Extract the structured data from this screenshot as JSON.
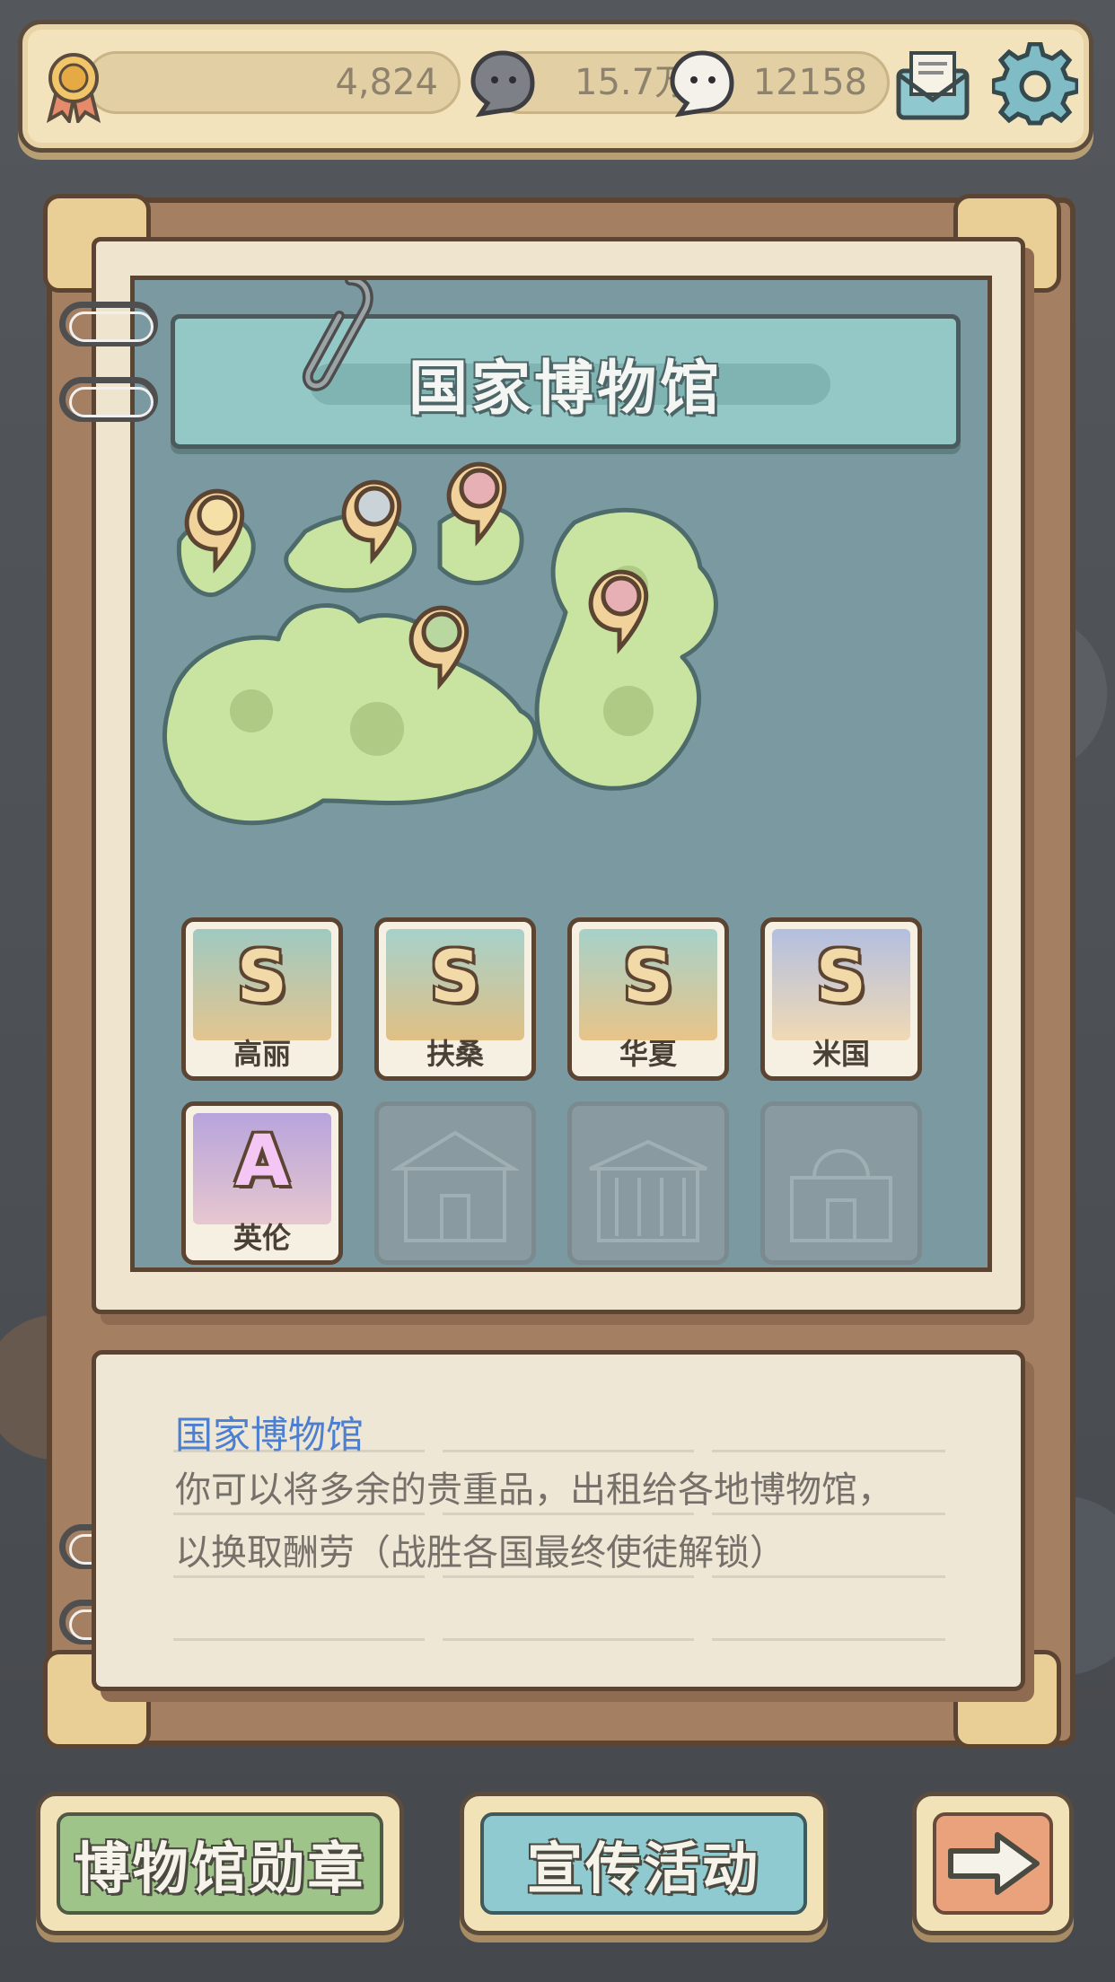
{
  "topbar": {
    "medal_value": "4,824",
    "dark_ghost_value": "15.7万",
    "light_ghost_value": "12158"
  },
  "title": "国家博物馆",
  "cards": [
    {
      "grade": "S",
      "name": "高丽",
      "locked": false
    },
    {
      "grade": "S",
      "name": "扶桑",
      "locked": false
    },
    {
      "grade": "S",
      "name": "华夏",
      "locked": false
    },
    {
      "grade": "S",
      "name": "米国",
      "locked": false
    },
    {
      "grade": "A",
      "name": "英伦",
      "locked": false
    },
    {
      "grade": "",
      "name": "",
      "locked": true
    },
    {
      "grade": "",
      "name": "",
      "locked": true
    },
    {
      "grade": "",
      "name": "",
      "locked": true
    }
  ],
  "description": {
    "title": "国家博物馆",
    "line1": "你可以将多余的贵重品，出租给各地博物馆，",
    "line2": "以换取酬劳（战胜各国最终使徒解锁）"
  },
  "buttons": {
    "medal": "博物馆勋章",
    "promo": "宣传活动"
  },
  "icons": {
    "medal": "medal-icon",
    "dark_ghost": "dark-ghost-icon",
    "light_ghost": "light-ghost-icon",
    "mail": "mail-icon",
    "settings": "gear-icon",
    "next": "arrow-right-icon"
  },
  "colors": {
    "green_button": "#9fc48a",
    "teal_button": "#8fcad0",
    "orange_button": "#eaa27d",
    "desc_title": "#4d7fd1"
  }
}
